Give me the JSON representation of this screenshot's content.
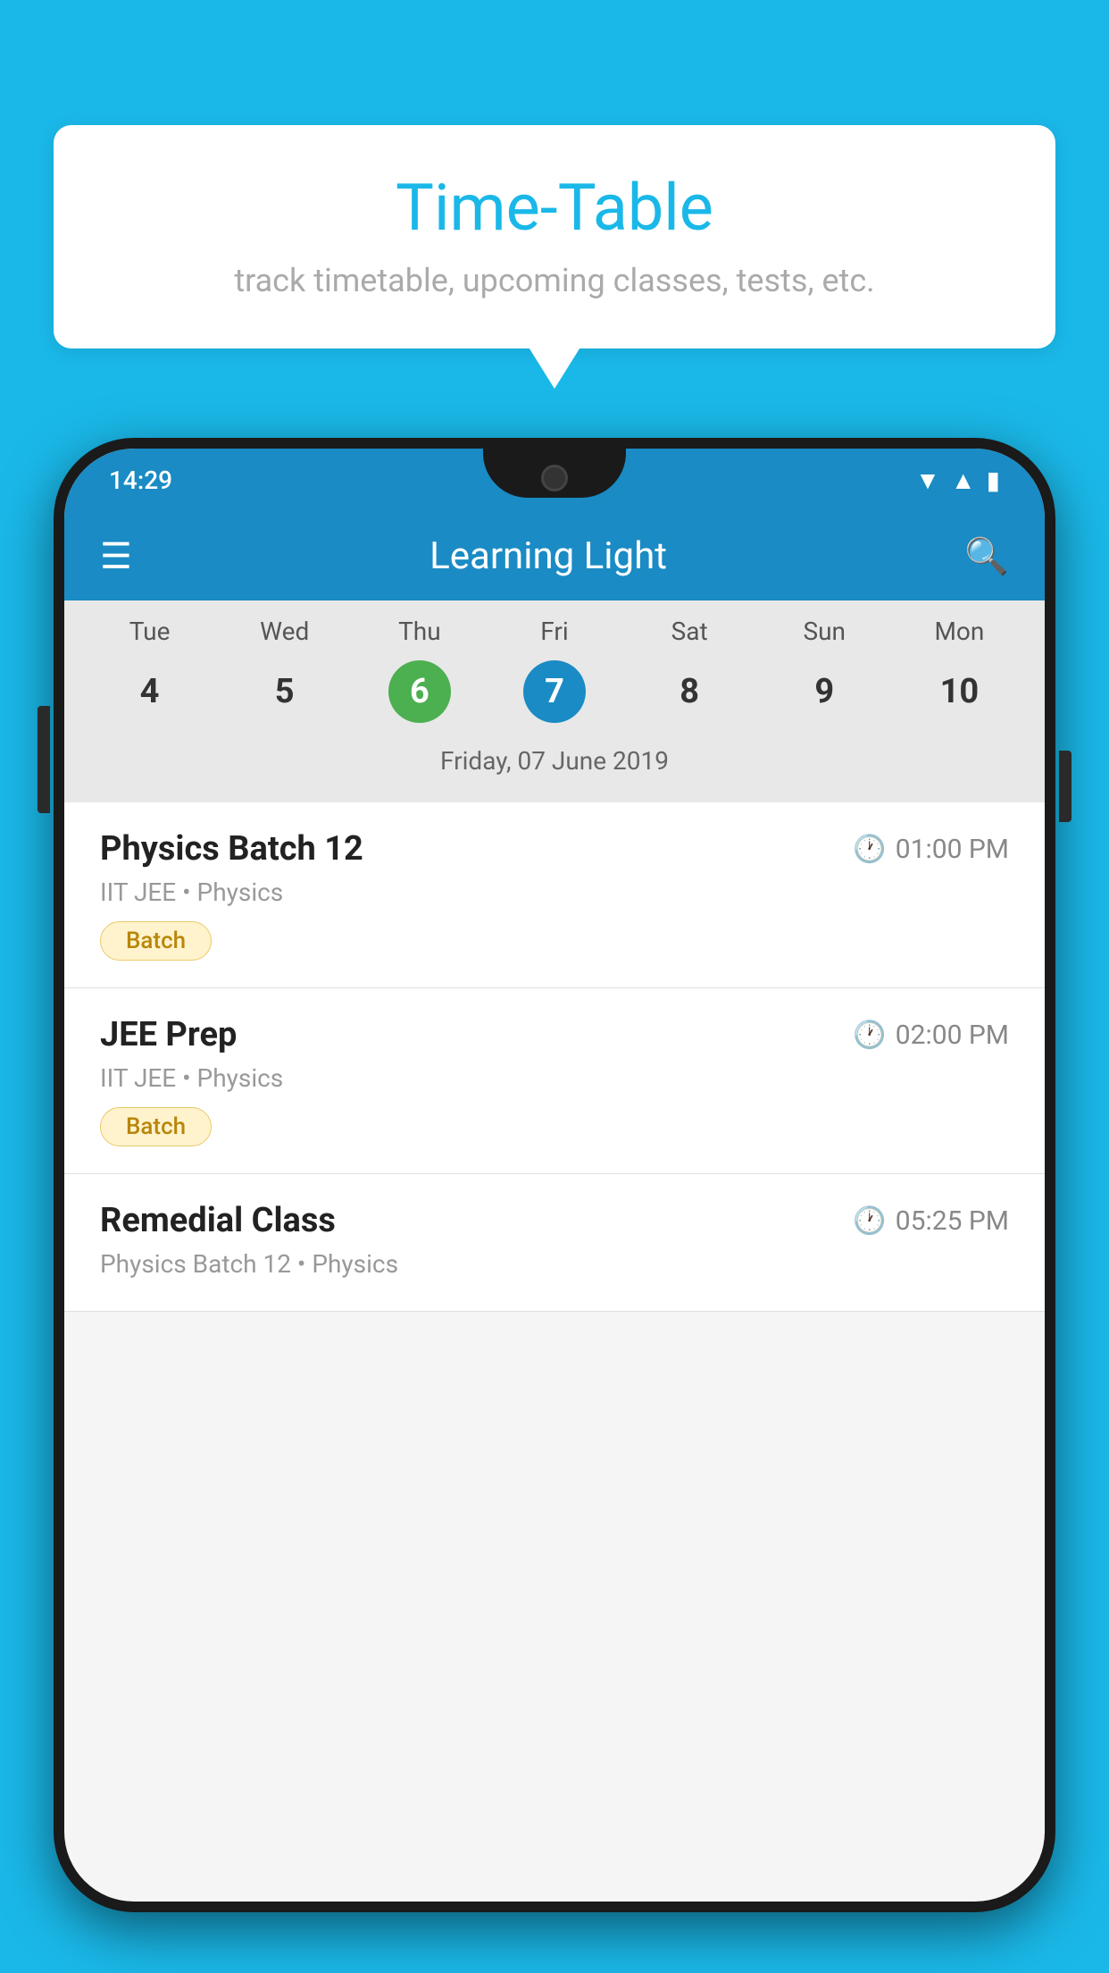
{
  "background_color": "#1ab8e8",
  "tooltip": {
    "title": "Time-Table",
    "subtitle": "track timetable, upcoming classes, tests, etc."
  },
  "phone": {
    "status_bar": {
      "time": "14:29"
    },
    "app_bar": {
      "title": "Learning Light"
    },
    "calendar": {
      "weekdays": [
        "Tue",
        "Wed",
        "Thu",
        "Fri",
        "Sat",
        "Sun",
        "Mon"
      ],
      "dates": [
        {
          "num": "4",
          "state": "normal"
        },
        {
          "num": "5",
          "state": "normal"
        },
        {
          "num": "6",
          "state": "today"
        },
        {
          "num": "7",
          "state": "selected"
        },
        {
          "num": "8",
          "state": "normal"
        },
        {
          "num": "9",
          "state": "normal"
        },
        {
          "num": "10",
          "state": "normal"
        }
      ],
      "selected_date_label": "Friday, 07 June 2019"
    },
    "schedule": [
      {
        "title": "Physics Batch 12",
        "time": "01:00 PM",
        "subtitle": "IIT JEE • Physics",
        "badge": "Batch"
      },
      {
        "title": "JEE Prep",
        "time": "02:00 PM",
        "subtitle": "IIT JEE • Physics",
        "badge": "Batch"
      },
      {
        "title": "Remedial Class",
        "time": "05:25 PM",
        "subtitle": "Physics Batch 12 • Physics",
        "badge": null
      }
    ]
  }
}
